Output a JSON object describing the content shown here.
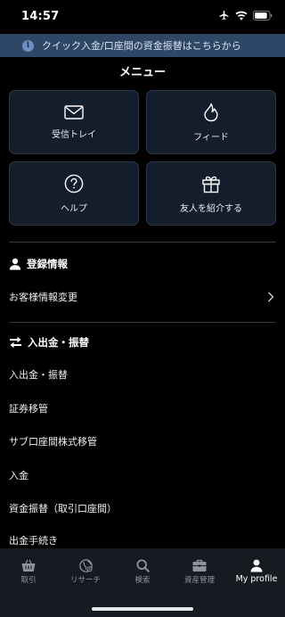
{
  "status_bar": {
    "time": "14:57"
  },
  "banner": {
    "text": "クイック入金/口座間の資金振替はこちらから",
    "icon": "info-icon"
  },
  "page_title": "メニュー",
  "tiles": [
    {
      "label": "受信トレイ",
      "icon": "envelope-icon"
    },
    {
      "label": "フィード",
      "icon": "flame-icon"
    },
    {
      "label": "ヘルプ",
      "icon": "help-icon"
    },
    {
      "label": "友人を紹介する",
      "icon": "gift-icon"
    }
  ],
  "sections": {
    "registration": {
      "title": "登録情報",
      "icon": "person-icon",
      "items": [
        {
          "label": "お客様情報変更",
          "icon": "chevron-right-icon"
        }
      ]
    },
    "transfer": {
      "title": "入出金・振替",
      "icon": "swap-arrows-icon",
      "items": [
        {
          "label": "入出金・振替"
        },
        {
          "label": "証券移管"
        },
        {
          "label": "サブ口座間株式移管"
        },
        {
          "label": "入金"
        },
        {
          "label": "資金振替（取引口座間）"
        },
        {
          "label": "出金手続き"
        }
      ]
    }
  },
  "tab_bar": {
    "active": "My profile",
    "tabs": [
      {
        "label": "取引",
        "icon": "basket-icon"
      },
      {
        "label": "リサーチ",
        "icon": "globe-icon"
      },
      {
        "label": "検索",
        "icon": "search-icon"
      },
      {
        "label": "資産管理",
        "icon": "briefcase-icon"
      },
      {
        "label": "My profile",
        "icon": "profile-icon"
      }
    ]
  },
  "colors": {
    "background": "#000000",
    "banner": "#2f4767",
    "tile": "#131d2b",
    "tab_bar": "#161b21",
    "inactive_tab": "#8e959e"
  }
}
